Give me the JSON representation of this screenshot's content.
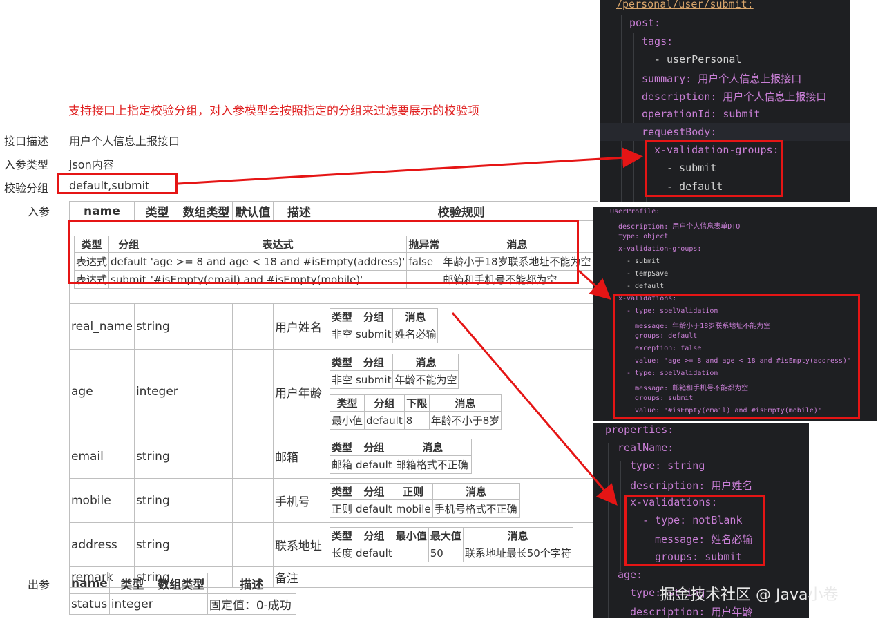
{
  "annotation": "支持接口上指定校验分组，对入参模型会按照指定的分组来过滤要展示的校验项",
  "info": {
    "desc_label": "接口描述",
    "desc_value": "用户个人信息上报接口",
    "type_label": "入参类型",
    "type_value": "json内容",
    "group_label": "校验分组",
    "group_value": "default,submit",
    "in_label": "入参",
    "out_label": "出参"
  },
  "main_table": {
    "headers": [
      "name",
      "类型",
      "数组类型",
      "默认值",
      "描述",
      "校验规则"
    ],
    "top_rules": {
      "headers": [
        "类型",
        "分组",
        "表达式",
        "抛异常",
        "消息"
      ],
      "rows": [
        [
          "表达式",
          "default",
          "'age >= 8 and age < 18 and #isEmpty(address)'",
          "false",
          "年龄小于18岁联系地址不能为空"
        ],
        [
          "表达式",
          "submit",
          "'#isEmpty(email) and #isEmpty(mobile)'",
          "",
          "邮箱和手机号不能都为空"
        ]
      ]
    },
    "rows": [
      {
        "name": "real_name",
        "type": "string",
        "desc": "用户姓名"
      },
      {
        "name": "age",
        "type": "integer",
        "desc": "用户年龄"
      },
      {
        "name": "email",
        "type": "string",
        "desc": "邮箱"
      },
      {
        "name": "mobile",
        "type": "string",
        "desc": "手机号"
      },
      {
        "name": "address",
        "type": "string",
        "desc": "联系地址"
      },
      {
        "name": "remark",
        "type": "string",
        "desc": "备注"
      }
    ],
    "rules": {
      "real_name": {
        "headers": [
          "类型",
          "分组",
          "消息"
        ],
        "row": [
          "非空",
          "submit",
          "姓名必输"
        ]
      },
      "age1": {
        "headers": [
          "类型",
          "分组",
          "消息"
        ],
        "row": [
          "非空",
          "submit",
          "年龄不能为空"
        ]
      },
      "age2": {
        "headers": [
          "类型",
          "分组",
          "下限",
          "消息"
        ],
        "row": [
          "最小值",
          "default",
          "8",
          "年龄不小于8岁"
        ]
      },
      "email": {
        "headers": [
          "类型",
          "分组",
          "消息"
        ],
        "row": [
          "邮箱",
          "default",
          "邮箱格式不正确"
        ]
      },
      "mobile": {
        "headers": [
          "类型",
          "分组",
          "正则",
          "消息"
        ],
        "row": [
          "正则",
          "default",
          "mobile",
          "手机号格式不正确"
        ]
      },
      "address": {
        "headers": [
          "类型",
          "分组",
          "最小值",
          "最大值",
          "消息"
        ],
        "row": [
          "长度",
          "default",
          "",
          "50",
          "联系地址最长50个字符"
        ]
      }
    }
  },
  "out_table": {
    "headers": [
      "name",
      "类型",
      "数组类型",
      "描述"
    ],
    "row": [
      "status",
      "integer",
      "",
      "固定值：0-成功"
    ]
  },
  "code1": {
    "lines": [
      "/personal/user/submit:",
      "post:",
      "tags:",
      "- userPersonal",
      "summary: 用户个人信息上报接口",
      "description: 用户个人信息上报接口",
      "operationId: submit",
      "requestBody:",
      "x-validation-groups:",
      "- submit",
      "- default"
    ]
  },
  "code2": {
    "lines": [
      "UserProfile:",
      "description: 用户个人信息表单DTO",
      "type: object",
      "x-validation-groups:",
      "- submit",
      "- tempSave",
      "- default",
      "x-validations:",
      "- type: spelValidation",
      "message: 年龄小于18岁联系地址不能为空",
      "groups: default",
      "exception: false",
      "value: 'age >= 8 and age < 18 and #isEmpty(address)'",
      "- type: spelValidation",
      "message: 邮箱和手机号不能都为空",
      "groups: submit",
      "value: '#isEmpty(email) and #isEmpty(mobile)'"
    ]
  },
  "code3": {
    "lines": [
      "properties:",
      "realName:",
      "type: string",
      "description: 用户姓名",
      "x-validations:",
      "- type: notBlank",
      "message: 姓名必输",
      "groups: submit",
      "age:",
      "type: string",
      "description: 用户年龄"
    ]
  },
  "watermark": "掘金技术社区 @ Java小卷",
  "colors": {
    "annotation": "#e02020",
    "highlight": "#e51515",
    "code_bg": "#1e1f22",
    "code_key": "#c97fd6",
    "code_value": "#d4d4d4"
  }
}
